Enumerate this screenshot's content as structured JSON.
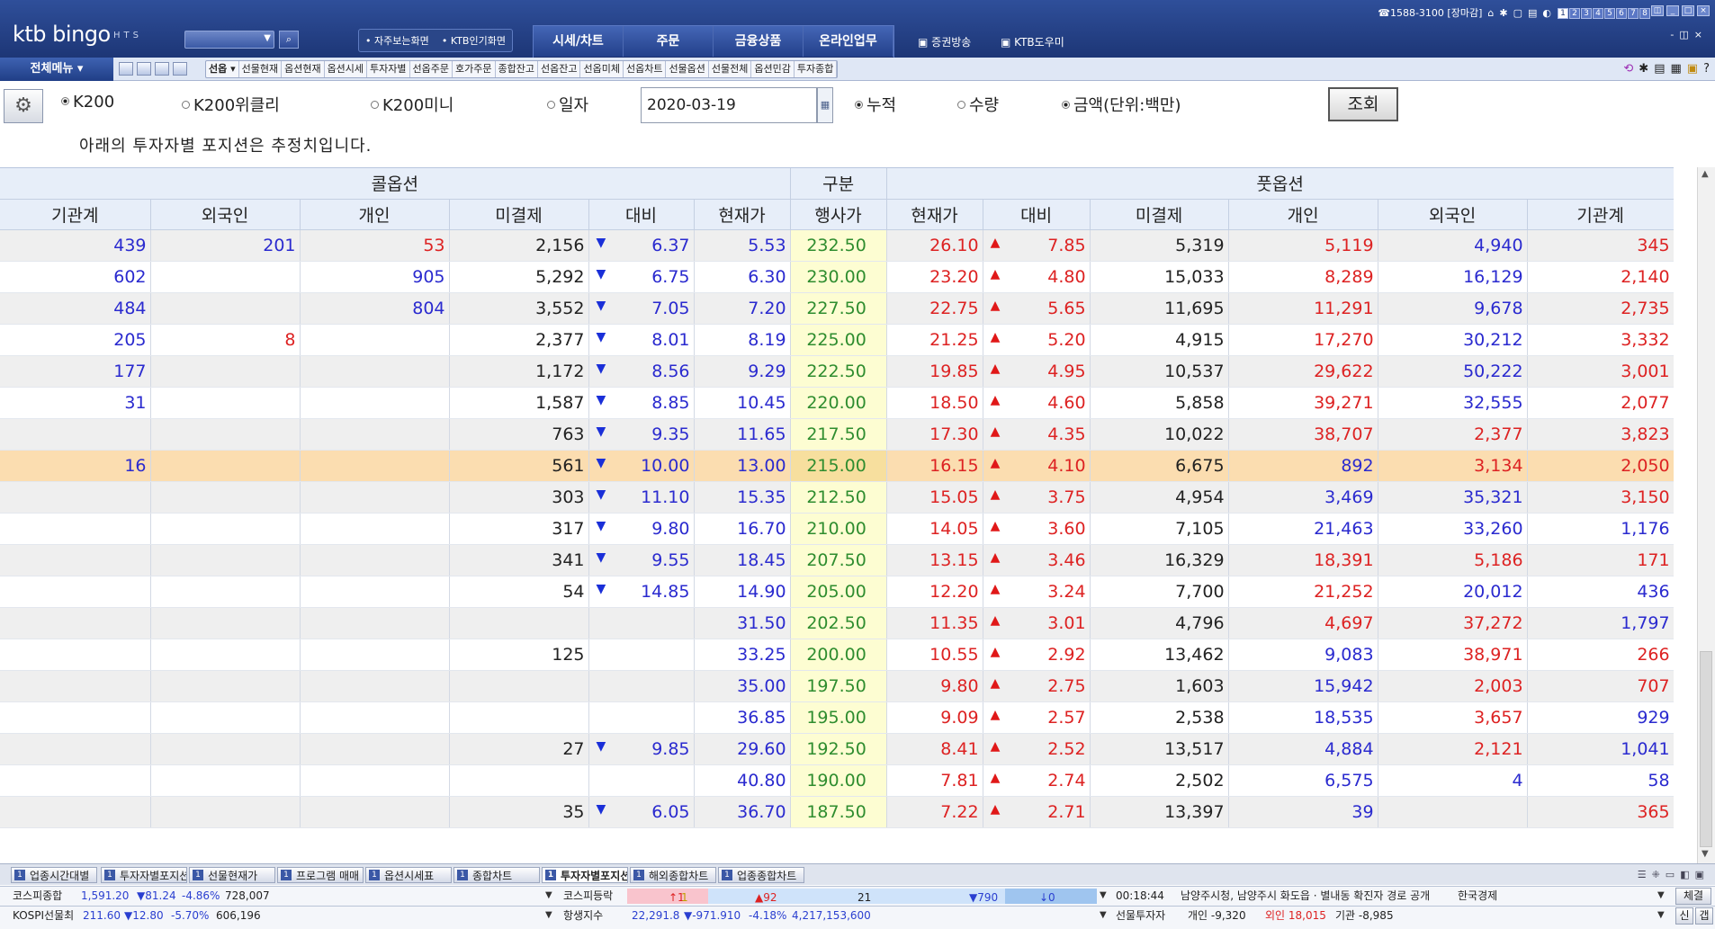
{
  "app": {
    "logo": "ktb bingo",
    "logo_sub": "HTS",
    "quick_links": [
      "• 자주보는화면",
      "• KTB인기화면"
    ],
    "main_menu": [
      "시세/차트",
      "주문",
      "금융상품",
      "온라인업무"
    ],
    "broadcast": "증권방송",
    "helper": "KTB도우미",
    "phone": "☎1588-3100 [장마감]",
    "screen_nums": [
      "1",
      "2",
      "3",
      "4",
      "5",
      "6",
      "7",
      "8"
    ],
    "all_menu": "전체메뉴 ▾",
    "screen_tabs": [
      "선옵 ▾",
      "선물현재",
      "옵션현재",
      "옵션시세",
      "투자자별",
      "선옵주문",
      "호가주문",
      "종합잔고",
      "선옵잔고",
      "선옵미체",
      "선옵차트",
      "선물옵션",
      "선물전체",
      "옵션민감",
      "투자종합"
    ]
  },
  "options": {
    "k200": "K200",
    "k200_weekly": "K200위클리",
    "k200_mini": "K200미니",
    "by_date": "일자",
    "date": "2020-03-19",
    "cumulative": "누적",
    "quantity": "수량",
    "amount": "금액(단위:백만)",
    "query": "조회",
    "notice": "아래의 투자자별 포지션은 추정치입니다."
  },
  "grid": {
    "group_call": "콜옵션",
    "group_mid": "구분",
    "group_put": "풋옵션",
    "columns": [
      "기관계",
      "외국인",
      "개인",
      "미결제",
      "대비",
      "현재가",
      "행사가",
      "현재가",
      "대비",
      "미결제",
      "개인",
      "외국인",
      "기관계"
    ],
    "rows": [
      {
        "c_inst": "439",
        "c_for": "201",
        "c_ind": "53",
        "c_oi": "2,156",
        "c_chg": "6.37",
        "c_px": "5.53",
        "strike": "232.50",
        "p_px": "26.10",
        "p_chg": "7.85",
        "p_oi": "5,319",
        "p_ind": "5,119",
        "p_for": "4,940",
        "p_inst": "345",
        "c_ind_c": "red",
        "c_for_c": "blue",
        "c_inst_c": "blue",
        "p_ind_c": "red",
        "p_for_c": "blue",
        "p_inst_c": "red"
      },
      {
        "c_inst": "602",
        "c_for": "",
        "c_ind": "905",
        "c_oi": "5,292",
        "c_chg": "6.75",
        "c_px": "6.30",
        "strike": "230.00",
        "p_px": "23.20",
        "p_chg": "4.80",
        "p_oi": "15,033",
        "p_ind": "8,289",
        "p_for": "16,129",
        "p_inst": "2,140",
        "c_ind_c": "blue",
        "c_for_c": "blue",
        "c_inst_c": "blue",
        "p_ind_c": "red",
        "p_for_c": "blue",
        "p_inst_c": "red"
      },
      {
        "c_inst": "484",
        "c_for": "",
        "c_ind": "804",
        "c_oi": "3,552",
        "c_chg": "7.05",
        "c_px": "7.20",
        "strike": "227.50",
        "p_px": "22.75",
        "p_chg": "5.65",
        "p_oi": "11,695",
        "p_ind": "11,291",
        "p_for": "9,678",
        "p_inst": "2,735",
        "c_ind_c": "blue",
        "c_for_c": "blue",
        "c_inst_c": "blue",
        "p_ind_c": "red",
        "p_for_c": "blue",
        "p_inst_c": "red"
      },
      {
        "c_inst": "205",
        "c_for": "8",
        "c_ind": "",
        "c_oi": "2,377",
        "c_chg": "8.01",
        "c_px": "8.19",
        "strike": "225.00",
        "p_px": "21.25",
        "p_chg": "5.20",
        "p_oi": "4,915",
        "p_ind": "17,270",
        "p_for": "30,212",
        "p_inst": "3,332",
        "c_ind_c": "blue",
        "c_for_c": "red",
        "c_inst_c": "blue",
        "p_ind_c": "red",
        "p_for_c": "blue",
        "p_inst_c": "red"
      },
      {
        "c_inst": "177",
        "c_for": "",
        "c_ind": "",
        "c_oi": "1,172",
        "c_chg": "8.56",
        "c_px": "9.29",
        "strike": "222.50",
        "p_px": "19.85",
        "p_chg": "4.95",
        "p_oi": "10,537",
        "p_ind": "29,622",
        "p_for": "50,222",
        "p_inst": "3,001",
        "c_ind_c": "blue",
        "c_for_c": "blue",
        "c_inst_c": "blue",
        "p_ind_c": "red",
        "p_for_c": "blue",
        "p_inst_c": "red"
      },
      {
        "c_inst": "31",
        "c_for": "",
        "c_ind": "",
        "c_oi": "1,587",
        "c_chg": "8.85",
        "c_px": "10.45",
        "strike": "220.00",
        "p_px": "18.50",
        "p_chg": "4.60",
        "p_oi": "5,858",
        "p_ind": "39,271",
        "p_for": "32,555",
        "p_inst": "2,077",
        "c_ind_c": "blue",
        "c_for_c": "blue",
        "c_inst_c": "blue",
        "p_ind_c": "red",
        "p_for_c": "blue",
        "p_inst_c": "red"
      },
      {
        "c_inst": "",
        "c_for": "",
        "c_ind": "",
        "c_oi": "763",
        "c_chg": "9.35",
        "c_px": "11.65",
        "strike": "217.50",
        "p_px": "17.30",
        "p_chg": "4.35",
        "p_oi": "10,022",
        "p_ind": "38,707",
        "p_for": "2,377",
        "p_inst": "3,823",
        "c_ind_c": "blue",
        "c_for_c": "blue",
        "c_inst_c": "blue",
        "p_ind_c": "red",
        "p_for_c": "red",
        "p_inst_c": "red"
      },
      {
        "c_inst": "16",
        "c_for": "",
        "c_ind": "",
        "c_oi": "561",
        "c_chg": "10.00",
        "c_px": "13.00",
        "strike": "215.00",
        "p_px": "16.15",
        "p_chg": "4.10",
        "p_oi": "6,675",
        "p_ind": "892",
        "p_for": "3,134",
        "p_inst": "2,050",
        "c_ind_c": "blue",
        "c_for_c": "blue",
        "c_inst_c": "blue",
        "p_ind_c": "blue",
        "p_for_c": "red",
        "p_inst_c": "red",
        "highlight": true
      },
      {
        "c_inst": "",
        "c_for": "",
        "c_ind": "",
        "c_oi": "303",
        "c_chg": "11.10",
        "c_px": "15.35",
        "strike": "212.50",
        "p_px": "15.05",
        "p_chg": "3.75",
        "p_oi": "4,954",
        "p_ind": "3,469",
        "p_for": "35,321",
        "p_inst": "3,150",
        "c_ind_c": "blue",
        "c_for_c": "blue",
        "c_inst_c": "blue",
        "p_ind_c": "blue",
        "p_for_c": "blue",
        "p_inst_c": "red"
      },
      {
        "c_inst": "",
        "c_for": "",
        "c_ind": "",
        "c_oi": "317",
        "c_chg": "9.80",
        "c_px": "16.70",
        "strike": "210.00",
        "p_px": "14.05",
        "p_chg": "3.60",
        "p_oi": "7,105",
        "p_ind": "21,463",
        "p_for": "33,260",
        "p_inst": "1,176",
        "c_ind_c": "blue",
        "c_for_c": "blue",
        "c_inst_c": "blue",
        "p_ind_c": "blue",
        "p_for_c": "blue",
        "p_inst_c": "blue"
      },
      {
        "c_inst": "",
        "c_for": "",
        "c_ind": "",
        "c_oi": "341",
        "c_chg": "9.55",
        "c_px": "18.45",
        "strike": "207.50",
        "p_px": "13.15",
        "p_chg": "3.46",
        "p_oi": "16,329",
        "p_ind": "18,391",
        "p_for": "5,186",
        "p_inst": "171",
        "c_ind_c": "blue",
        "c_for_c": "blue",
        "c_inst_c": "blue",
        "p_ind_c": "red",
        "p_for_c": "red",
        "p_inst_c": "red"
      },
      {
        "c_inst": "",
        "c_for": "",
        "c_ind": "",
        "c_oi": "54",
        "c_chg": "14.85",
        "c_px": "14.90",
        "strike": "205.00",
        "p_px": "12.20",
        "p_chg": "3.24",
        "p_oi": "7,700",
        "p_ind": "21,252",
        "p_for": "20,012",
        "p_inst": "436",
        "c_ind_c": "blue",
        "c_for_c": "blue",
        "c_inst_c": "blue",
        "p_ind_c": "red",
        "p_for_c": "blue",
        "p_inst_c": "blue"
      },
      {
        "c_inst": "",
        "c_for": "",
        "c_ind": "",
        "c_oi": "",
        "c_chg": "",
        "c_px": "31.50",
        "strike": "202.50",
        "p_px": "11.35",
        "p_chg": "3.01",
        "p_oi": "4,796",
        "p_ind": "4,697",
        "p_for": "37,272",
        "p_inst": "1,797",
        "c_ind_c": "blue",
        "c_for_c": "blue",
        "c_inst_c": "blue",
        "p_ind_c": "red",
        "p_for_c": "red",
        "p_inst_c": "blue"
      },
      {
        "c_inst": "",
        "c_for": "",
        "c_ind": "",
        "c_oi": "125",
        "c_chg": "",
        "c_px": "33.25",
        "strike": "200.00",
        "p_px": "10.55",
        "p_chg": "2.92",
        "p_oi": "13,462",
        "p_ind": "9,083",
        "p_for": "38,971",
        "p_inst": "266",
        "c_ind_c": "blue",
        "c_for_c": "blue",
        "c_inst_c": "blue",
        "p_ind_c": "blue",
        "p_for_c": "red",
        "p_inst_c": "red"
      },
      {
        "c_inst": "",
        "c_for": "",
        "c_ind": "",
        "c_oi": "",
        "c_chg": "",
        "c_px": "35.00",
        "strike": "197.50",
        "p_px": "9.80",
        "p_chg": "2.75",
        "p_oi": "1,603",
        "p_ind": "15,942",
        "p_for": "2,003",
        "p_inst": "707",
        "c_ind_c": "blue",
        "c_for_c": "blue",
        "c_inst_c": "blue",
        "p_ind_c": "blue",
        "p_for_c": "red",
        "p_inst_c": "red"
      },
      {
        "c_inst": "",
        "c_for": "",
        "c_ind": "",
        "c_oi": "",
        "c_chg": "",
        "c_px": "36.85",
        "strike": "195.00",
        "p_px": "9.09",
        "p_chg": "2.57",
        "p_oi": "2,538",
        "p_ind": "18,535",
        "p_for": "3,657",
        "p_inst": "929",
        "c_ind_c": "blue",
        "c_for_c": "blue",
        "c_inst_c": "blue",
        "p_ind_c": "blue",
        "p_for_c": "red",
        "p_inst_c": "blue"
      },
      {
        "c_inst": "",
        "c_for": "",
        "c_ind": "",
        "c_oi": "27",
        "c_chg": "9.85",
        "c_px": "29.60",
        "strike": "192.50",
        "p_px": "8.41",
        "p_chg": "2.52",
        "p_oi": "13,517",
        "p_ind": "4,884",
        "p_for": "2,121",
        "p_inst": "1,041",
        "c_ind_c": "blue",
        "c_for_c": "blue",
        "c_inst_c": "blue",
        "p_ind_c": "blue",
        "p_for_c": "red",
        "p_inst_c": "blue"
      },
      {
        "c_inst": "",
        "c_for": "",
        "c_ind": "",
        "c_oi": "",
        "c_chg": "",
        "c_px": "40.80",
        "strike": "190.00",
        "p_px": "7.81",
        "p_chg": "2.74",
        "p_oi": "2,502",
        "p_ind": "6,575",
        "p_for": "4",
        "p_inst": "58",
        "c_ind_c": "blue",
        "c_for_c": "blue",
        "c_inst_c": "blue",
        "p_ind_c": "blue",
        "p_for_c": "blue",
        "p_inst_c": "blue"
      },
      {
        "c_inst": "",
        "c_for": "",
        "c_ind": "",
        "c_oi": "35",
        "c_chg": "6.05",
        "c_px": "36.70",
        "strike": "187.50",
        "p_px": "7.22",
        "p_chg": "2.71",
        "p_oi": "13,397",
        "p_ind": "39",
        "p_for": "",
        "p_inst": "365",
        "c_ind_c": "blue",
        "c_for_c": "blue",
        "c_inst_c": "blue",
        "p_ind_c": "blue",
        "p_for_c": "blue",
        "p_inst_c": "red"
      }
    ]
  },
  "window_tabs": [
    "업종시간대별",
    "투자자별포지션",
    "선물현재가",
    "프로그램 매매",
    "옵션시세표",
    "종합차트",
    "투자자별포지션",
    "해외종합차트",
    "업종종합차트"
  ],
  "ticker1": {
    "name": "코스피종합",
    "value": "1,591.20",
    "change": "▼81.24",
    "pct": "-4.86%",
    "volume": "728,007",
    "adv_label": "코스피등락",
    "adv_up": "↑1",
    "adv_up2": "1",
    "adv_rise": "▲92",
    "adv_flat": "21",
    "adv_fall": "▼790",
    "adv_low": "↓0",
    "news_time": "00:18:44",
    "news": "남양주시청, 남양주시 화도읍 · 별내동 확진자 경로 공개",
    "news_src": "한국경제",
    "btn": "체결"
  },
  "ticker2": {
    "name": "KOSPI선물최",
    "value": "211.60",
    "change": "▼12.80",
    "pct": "-5.70%",
    "volume": "606,196",
    "idx_label": "항생지수",
    "idx_value": "22,291.8",
    "idx_change": "▼-971.910",
    "idx_pct": "-4.18%",
    "idx_vol": "4,217,153,600",
    "inv_label": "선물투자자",
    "ind": "개인 -9,320",
    "for": "외인 18,015",
    "inst": "기관 -8,985",
    "btn_new": "신",
    "btn_gap": "갭"
  }
}
